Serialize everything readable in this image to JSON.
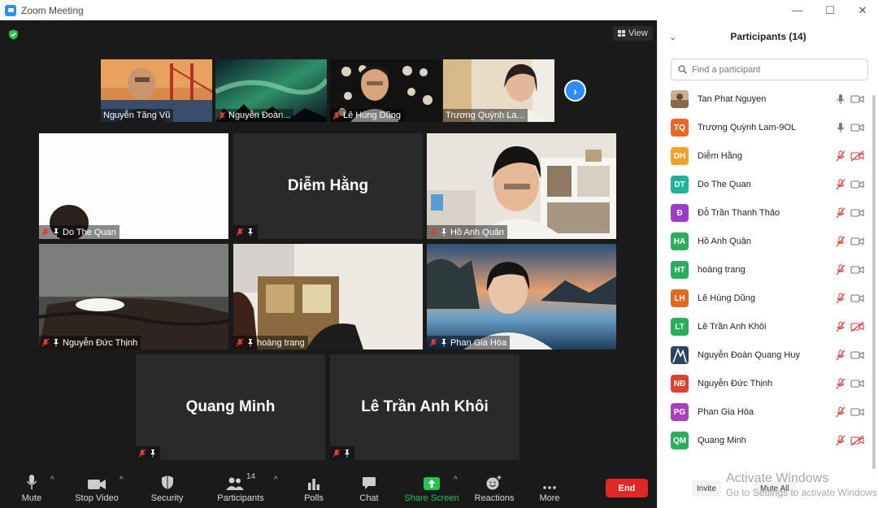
{
  "window": {
    "title": "Zoom Meeting",
    "minimize": "—",
    "maximize": "☐",
    "close": "✕"
  },
  "meeting": {
    "view_label": "View",
    "thumbnails": [
      {
        "name": "Nguyễn Tăng Vũ",
        "muted": false
      },
      {
        "name": "Nguyễn Đoàn...",
        "muted": true
      },
      {
        "name": "Lê Hùng Dũng",
        "muted": true
      },
      {
        "name": "Trương Quỳnh La...",
        "muted": false
      }
    ],
    "tiles": [
      {
        "name": "Do The Quan",
        "big_name": "",
        "pinned": true
      },
      {
        "name": "",
        "big_name": "Diễm Hằng",
        "pinned": true
      },
      {
        "name": "Hồ Anh Quân",
        "big_name": "",
        "pinned": true
      },
      {
        "name": "Nguyễn Đức Thịnh",
        "big_name": "",
        "pinned": true
      },
      {
        "name": "hoàng trang",
        "big_name": "",
        "pinned": true
      },
      {
        "name": "Phan Gia Hòa",
        "big_name": "",
        "pinned": true
      },
      {
        "name": "",
        "big_name": "Quang Minh",
        "pinned": true
      },
      {
        "name": "",
        "big_name": "Lê Trần Anh Khôi",
        "pinned": true
      }
    ]
  },
  "toolbar": {
    "mute": "Mute",
    "stop_video": "Stop Video",
    "security": "Security",
    "participants": "Participants",
    "participants_count": "14",
    "polls": "Polls",
    "chat": "Chat",
    "share_screen": "Share Screen",
    "reactions": "Reactions",
    "more": "More",
    "end": "End"
  },
  "panel": {
    "title": "Participants (14)",
    "search_placeholder": "Find a participant",
    "invite": "Invite",
    "mute_all": "Mute All",
    "participants": [
      {
        "initials": "",
        "name": "Tan Phat Nguyen",
        "color": "#c9b08f",
        "mic": "on",
        "cam": "on"
      },
      {
        "initials": "TQ",
        "name": "Trương Quỳnh Lam-9OL",
        "color": "#e8682a",
        "mic": "on",
        "cam": "on"
      },
      {
        "initials": "DH",
        "name": "Diễm Hằng",
        "color": "#f2a22b",
        "mic": "off",
        "cam": "off"
      },
      {
        "initials": "DT",
        "name": "Do The Quan",
        "color": "#1eb39a",
        "mic": "off",
        "cam": "on"
      },
      {
        "initials": "Đ",
        "name": "Đỗ Trần Thanh Thảo",
        "color": "#9b3dc8",
        "mic": "off",
        "cam": "on"
      },
      {
        "initials": "HA",
        "name": "Hồ Anh Quân",
        "color": "#2aae5d",
        "mic": "off",
        "cam": "on"
      },
      {
        "initials": "HT",
        "name": "hoàng trang",
        "color": "#2aae5d",
        "mic": "off",
        "cam": "on"
      },
      {
        "initials": "LH",
        "name": "Lê Hùng Dũng",
        "color": "#e06a1e",
        "mic": "off",
        "cam": "on"
      },
      {
        "initials": "LT",
        "name": "Lê Trần Anh Khôi",
        "color": "#2aae5d",
        "mic": "off",
        "cam": "off"
      },
      {
        "initials": "",
        "name": "Nguyễn Đoàn Quang Huy",
        "color": "#3a5a7a",
        "mic": "off",
        "cam": "on"
      },
      {
        "initials": "NĐ",
        "name": "Nguyễn Đức Thịnh",
        "color": "#d9442f",
        "mic": "off",
        "cam": "on"
      },
      {
        "initials": "PG",
        "name": "Phan Gia Hòa",
        "color": "#a83fbf",
        "mic": "off",
        "cam": "on"
      },
      {
        "initials": "QM",
        "name": "Quang Minh",
        "color": "#2aae5d",
        "mic": "off",
        "cam": "off"
      }
    ]
  },
  "watermark": {
    "line1": "Activate Windows",
    "line2": "Go to Settings to activate Windows."
  }
}
